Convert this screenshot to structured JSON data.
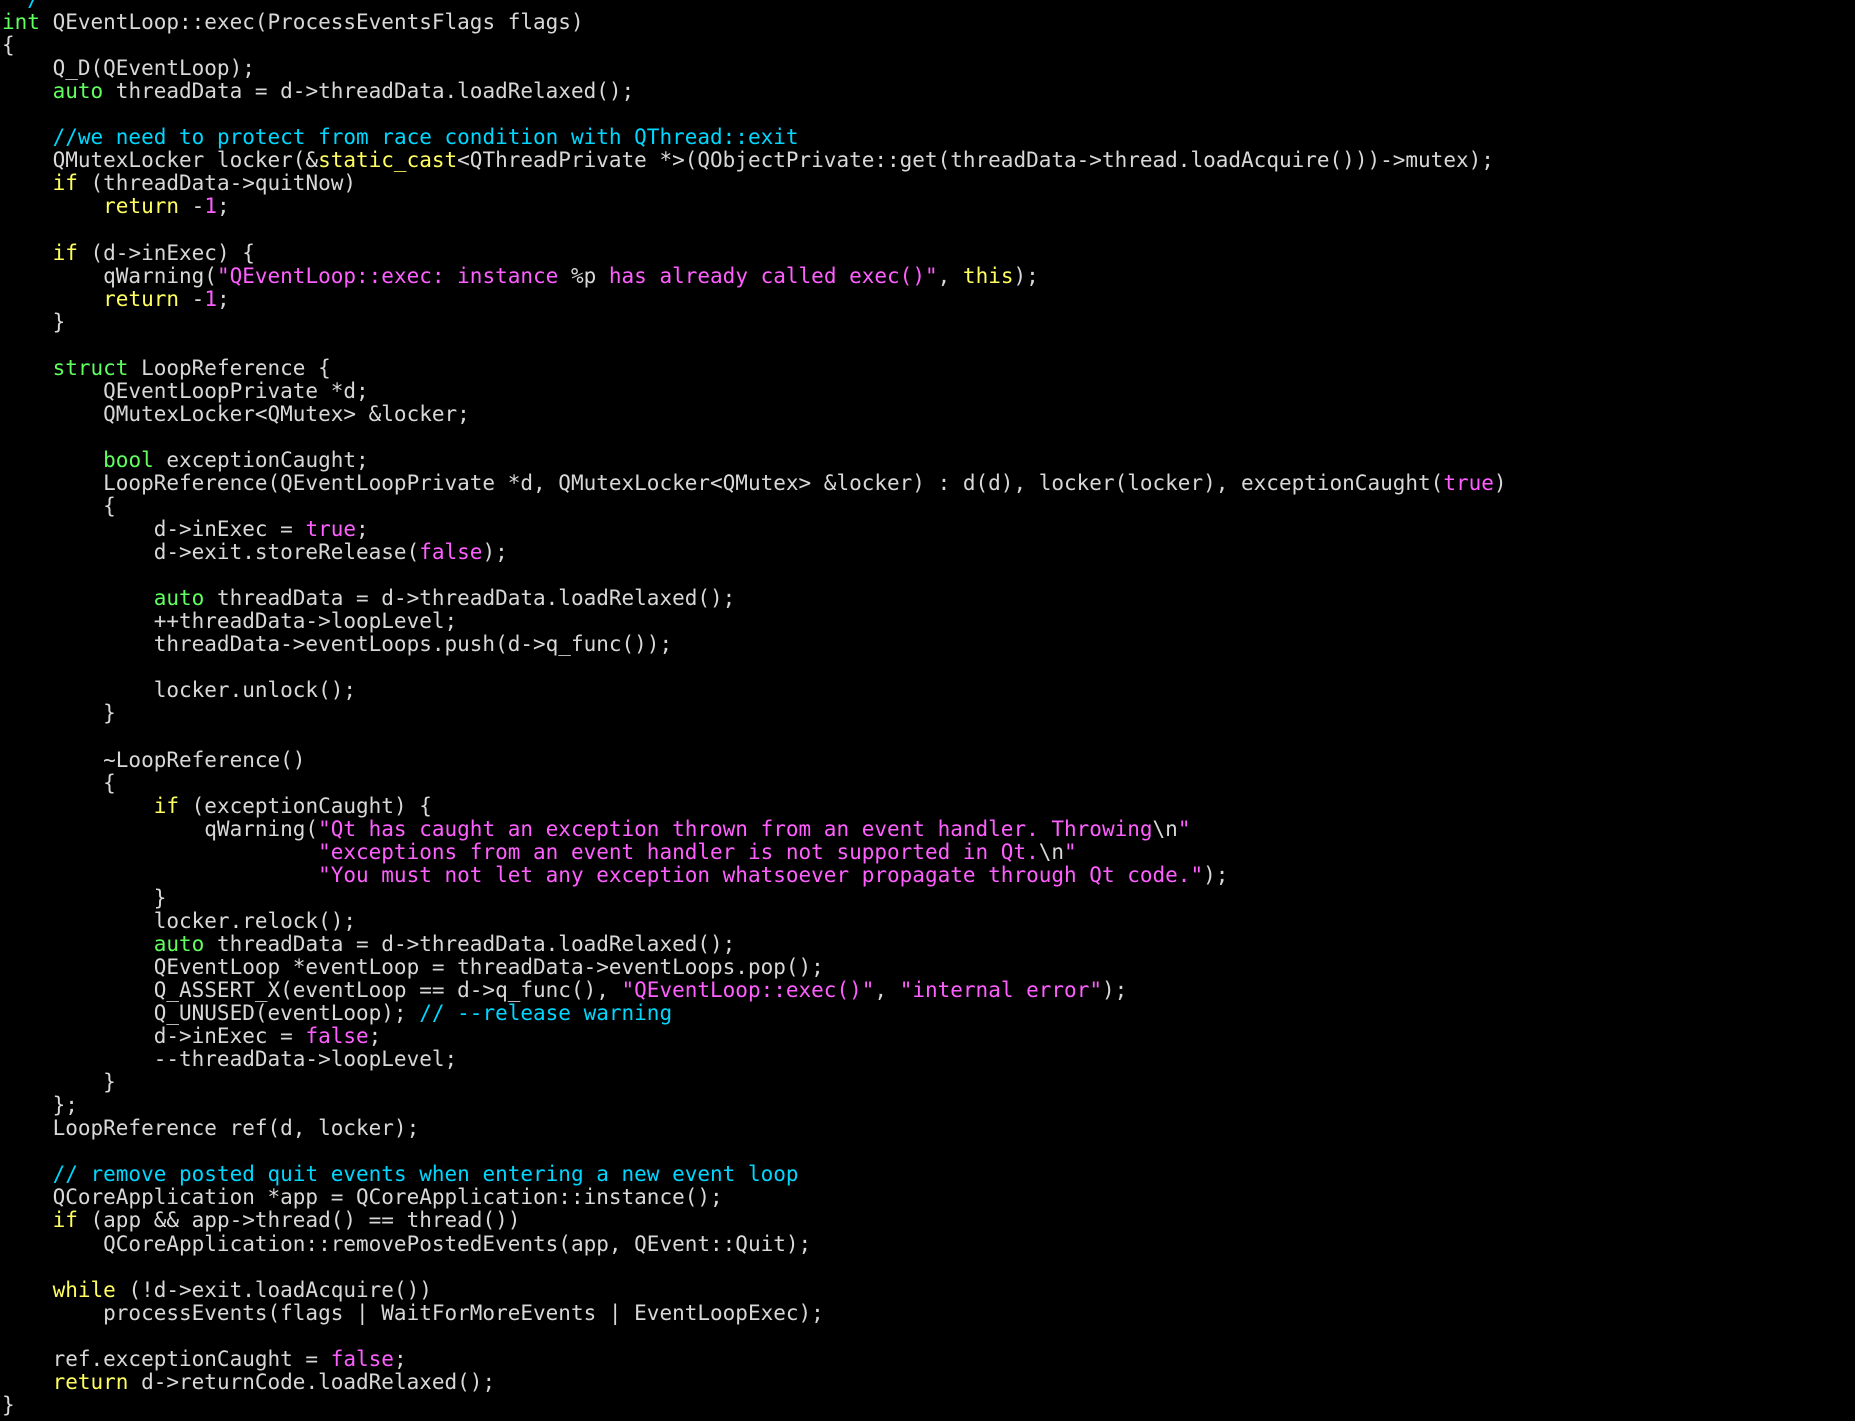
{
  "colors": {
    "background": "#000000",
    "plain": "#d8d8d8",
    "keyword": "#ffff5f",
    "type": "#5fff5f",
    "string": "#ff5fff",
    "comment": "#00d7ff"
  },
  "lines": [
    [
      [
        "cmt",
        " */"
      ]
    ],
    [
      [
        "type",
        "int"
      ],
      [
        "plain",
        " QEventLoop::exec(ProcessEventsFlags flags)"
      ]
    ],
    [
      [
        "plain",
        "{"
      ]
    ],
    [
      [
        "plain",
        "    Q_D(QEventLoop);"
      ]
    ],
    [
      [
        "plain",
        "    "
      ],
      [
        "type",
        "auto"
      ],
      [
        "plain",
        " threadData = d->threadData.loadRelaxed();"
      ]
    ],
    [],
    [
      [
        "plain",
        "    "
      ],
      [
        "cmt",
        "//we need to protect from race condition with QThread::exit"
      ]
    ],
    [
      [
        "plain",
        "    QMutexLocker locker(&"
      ],
      [
        "kw",
        "static_cast"
      ],
      [
        "plain",
        "<QThreadPrivate *>(QObjectPrivate::get(threadData->thread.loadAcquire()))->mutex);"
      ]
    ],
    [
      [
        "plain",
        "    "
      ],
      [
        "kw",
        "if"
      ],
      [
        "plain",
        " (threadData->quitNow)"
      ]
    ],
    [
      [
        "plain",
        "        "
      ],
      [
        "kw",
        "return"
      ],
      [
        "plain",
        " -"
      ],
      [
        "str",
        "1"
      ],
      [
        "plain",
        ";"
      ]
    ],
    [],
    [
      [
        "plain",
        "    "
      ],
      [
        "kw",
        "if"
      ],
      [
        "plain",
        " (d->inExec) {"
      ]
    ],
    [
      [
        "plain",
        "        qWarning("
      ],
      [
        "str",
        "\"QEventLoop::exec: instance "
      ],
      [
        "plain",
        "%p"
      ],
      [
        "str",
        " has already called exec()\""
      ],
      [
        "plain",
        ", "
      ],
      [
        "kw",
        "this"
      ],
      [
        "plain",
        ");"
      ]
    ],
    [
      [
        "plain",
        "        "
      ],
      [
        "kw",
        "return"
      ],
      [
        "plain",
        " -"
      ],
      [
        "str",
        "1"
      ],
      [
        "plain",
        ";"
      ]
    ],
    [
      [
        "plain",
        "    }"
      ]
    ],
    [],
    [
      [
        "plain",
        "    "
      ],
      [
        "type",
        "struct"
      ],
      [
        "plain",
        " LoopReference {"
      ]
    ],
    [
      [
        "plain",
        "        QEventLoopPrivate *d;"
      ]
    ],
    [
      [
        "plain",
        "        QMutexLocker<QMutex> &locker;"
      ]
    ],
    [],
    [
      [
        "plain",
        "        "
      ],
      [
        "type",
        "bool"
      ],
      [
        "plain",
        " exceptionCaught;"
      ]
    ],
    [
      [
        "plain",
        "        LoopReference(QEventLoopPrivate *d, QMutexLocker<QMutex> &locker) : d(d), locker(locker), exceptionCaught("
      ],
      [
        "str",
        "true"
      ],
      [
        "plain",
        ")"
      ]
    ],
    [
      [
        "plain",
        "        {"
      ]
    ],
    [
      [
        "plain",
        "            d->inExec = "
      ],
      [
        "str",
        "true"
      ],
      [
        "plain",
        ";"
      ]
    ],
    [
      [
        "plain",
        "            d->exit.storeRelease("
      ],
      [
        "str",
        "false"
      ],
      [
        "plain",
        ");"
      ]
    ],
    [],
    [
      [
        "plain",
        "            "
      ],
      [
        "type",
        "auto"
      ],
      [
        "plain",
        " threadData = d->threadData.loadRelaxed();"
      ]
    ],
    [
      [
        "plain",
        "            ++threadData->loopLevel;"
      ]
    ],
    [
      [
        "plain",
        "            threadData->eventLoops.push(d->q_func());"
      ]
    ],
    [],
    [
      [
        "plain",
        "            locker.unlock();"
      ]
    ],
    [
      [
        "plain",
        "        }"
      ]
    ],
    [],
    [
      [
        "plain",
        "        ~LoopReference()"
      ]
    ],
    [
      [
        "plain",
        "        {"
      ]
    ],
    [
      [
        "plain",
        "            "
      ],
      [
        "kw",
        "if"
      ],
      [
        "plain",
        " (exceptionCaught) {"
      ]
    ],
    [
      [
        "plain",
        "                qWarning("
      ],
      [
        "str",
        "\"Qt has caught an exception thrown from an event handler. Throwing"
      ],
      [
        "plain",
        "\\n"
      ],
      [
        "str",
        "\""
      ]
    ],
    [
      [
        "plain",
        "                         "
      ],
      [
        "str",
        "\"exceptions from an event handler is not supported in Qt."
      ],
      [
        "plain",
        "\\n"
      ],
      [
        "str",
        "\""
      ]
    ],
    [
      [
        "plain",
        "                         "
      ],
      [
        "str",
        "\"You must not let any exception whatsoever propagate through Qt code.\""
      ],
      [
        "plain",
        ");"
      ]
    ],
    [
      [
        "plain",
        "            }"
      ]
    ],
    [
      [
        "plain",
        "            locker.relock();"
      ]
    ],
    [
      [
        "plain",
        "            "
      ],
      [
        "type",
        "auto"
      ],
      [
        "plain",
        " threadData = d->threadData.loadRelaxed();"
      ]
    ],
    [
      [
        "plain",
        "            QEventLoop *eventLoop = threadData->eventLoops.pop();"
      ]
    ],
    [
      [
        "plain",
        "            Q_ASSERT_X(eventLoop == d->q_func(), "
      ],
      [
        "str",
        "\"QEventLoop::exec()\""
      ],
      [
        "plain",
        ", "
      ],
      [
        "str",
        "\"internal error\""
      ],
      [
        "plain",
        ");"
      ]
    ],
    [
      [
        "plain",
        "            Q_UNUSED(eventLoop); "
      ],
      [
        "cmt",
        "// --release warning"
      ]
    ],
    [
      [
        "plain",
        "            d->inExec = "
      ],
      [
        "str",
        "false"
      ],
      [
        "plain",
        ";"
      ]
    ],
    [
      [
        "plain",
        "            --threadData->loopLevel;"
      ]
    ],
    [
      [
        "plain",
        "        }"
      ]
    ],
    [
      [
        "plain",
        "    };"
      ]
    ],
    [
      [
        "plain",
        "    LoopReference ref(d, locker);"
      ]
    ],
    [],
    [
      [
        "plain",
        "    "
      ],
      [
        "cmt",
        "// remove posted quit events when entering a new event loop"
      ]
    ],
    [
      [
        "plain",
        "    QCoreApplication *app = QCoreApplication::instance();"
      ]
    ],
    [
      [
        "plain",
        "    "
      ],
      [
        "kw",
        "if"
      ],
      [
        "plain",
        " (app && app->thread() == thread())"
      ]
    ],
    [
      [
        "plain",
        "        QCoreApplication::removePostedEvents(app, QEvent::Quit);"
      ]
    ],
    [],
    [
      [
        "plain",
        "    "
      ],
      [
        "kw",
        "while"
      ],
      [
        "plain",
        " (!d->exit.loadAcquire())"
      ]
    ],
    [
      [
        "plain",
        "        processEvents(flags | WaitForMoreEvents | EventLoopExec);"
      ]
    ],
    [],
    [
      [
        "plain",
        "    ref.exceptionCaught = "
      ],
      [
        "str",
        "false"
      ],
      [
        "plain",
        ";"
      ]
    ],
    [
      [
        "plain",
        "    "
      ],
      [
        "kw",
        "return"
      ],
      [
        "plain",
        " d->returnCode.loadRelaxed();"
      ]
    ],
    [
      [
        "plain",
        "}"
      ]
    ]
  ]
}
